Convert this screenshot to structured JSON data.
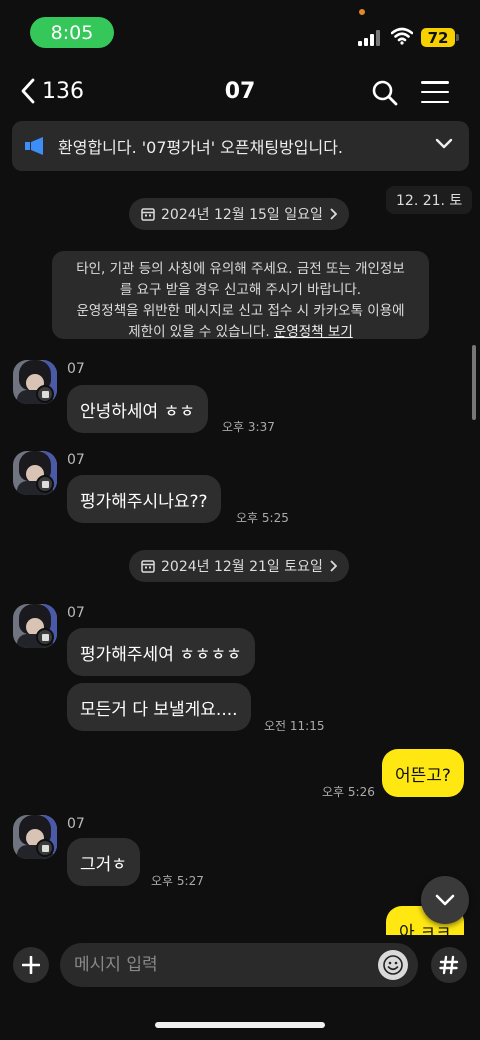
{
  "status": {
    "time": "8:05",
    "battery": "72"
  },
  "header": {
    "back_count": "136",
    "title": "07"
  },
  "notice": {
    "text": "환영합니다. '07평가녀' 오픈채팅방입니다."
  },
  "floating_date": "12. 21. 토",
  "dates": {
    "first": "2024년 12월 15일 일요일",
    "second": "2024년 12월 21일 토요일"
  },
  "warning": {
    "line1": "타인, 기관 등의 사칭에 유의해 주세요. 금전 또는 개인정보",
    "line2": "를 요구 받을 경우 신고해 주시기 바랍니다.",
    "line3": "운영정책을 위반한 메시지로 신고 접수 시 카카오톡 이용에",
    "line4_prefix": "제한이 있을 수 있습니다.",
    "link": "운영정책 보기"
  },
  "messages": [
    {
      "sender": "07",
      "text": "안녕하세여 ㅎㅎ",
      "time": "오후 3:37"
    },
    {
      "sender": "07",
      "text": "평가해주시나요??",
      "time": "오후 5:25"
    },
    {
      "sender": "07",
      "text": "평가해주세여 ㅎㅎㅎㅎ",
      "time": ""
    },
    {
      "sender": "07",
      "text": "모든거 다 보낼게요....",
      "time": "오전 11:15"
    },
    {
      "sender": "me",
      "text": "어뜬고?",
      "time": "오후 5:26"
    },
    {
      "sender": "07",
      "text": "그거ㅎ",
      "time": "오후 5:27"
    },
    {
      "sender": "me",
      "text": "아 ㅋㅋ",
      "time": ""
    }
  ],
  "input": {
    "placeholder": "메시지 입력"
  },
  "colors": {
    "my_bubble": "#ffe812",
    "their_bubble": "#2e2e2e",
    "background": "#0f0f0f"
  }
}
